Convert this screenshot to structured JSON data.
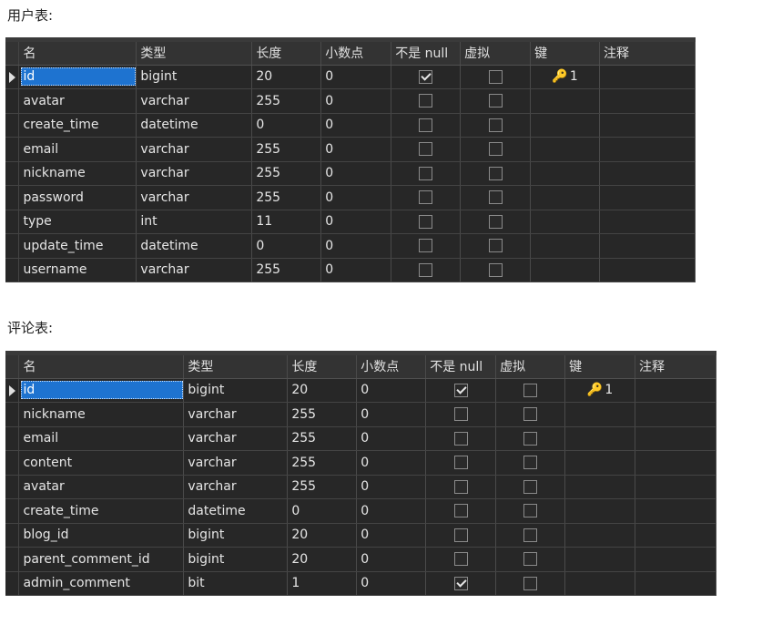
{
  "sections": [
    {
      "caption": "用户表:",
      "headers": [
        "名",
        "类型",
        "长度",
        "小数点",
        "不是 null",
        "虚拟",
        "键",
        "注释"
      ],
      "rows": [
        {
          "name": "id",
          "type": "bigint",
          "length": "20",
          "decimals": "0",
          "not_null": true,
          "virtual": false,
          "key": "1",
          "comment": ""
        },
        {
          "name": "avatar",
          "type": "varchar",
          "length": "255",
          "decimals": "0",
          "not_null": false,
          "virtual": false,
          "key": "",
          "comment": ""
        },
        {
          "name": "create_time",
          "type": "datetime",
          "length": "0",
          "decimals": "0",
          "not_null": false,
          "virtual": false,
          "key": "",
          "comment": ""
        },
        {
          "name": "email",
          "type": "varchar",
          "length": "255",
          "decimals": "0",
          "not_null": false,
          "virtual": false,
          "key": "",
          "comment": ""
        },
        {
          "name": "nickname",
          "type": "varchar",
          "length": "255",
          "decimals": "0",
          "not_null": false,
          "virtual": false,
          "key": "",
          "comment": ""
        },
        {
          "name": "password",
          "type": "varchar",
          "length": "255",
          "decimals": "0",
          "not_null": false,
          "virtual": false,
          "key": "",
          "comment": ""
        },
        {
          "name": "type",
          "type": "int",
          "length": "11",
          "decimals": "0",
          "not_null": false,
          "virtual": false,
          "key": "",
          "comment": ""
        },
        {
          "name": "update_time",
          "type": "datetime",
          "length": "0",
          "decimals": "0",
          "not_null": false,
          "virtual": false,
          "key": "",
          "comment": ""
        },
        {
          "name": "username",
          "type": "varchar",
          "length": "255",
          "decimals": "0",
          "not_null": false,
          "virtual": false,
          "key": "",
          "comment": ""
        }
      ]
    },
    {
      "caption": "评论表:",
      "headers": [
        "名",
        "类型",
        "长度",
        "小数点",
        "不是 null",
        "虚拟",
        "键",
        "注释"
      ],
      "rows": [
        {
          "name": "id",
          "type": "bigint",
          "length": "20",
          "decimals": "0",
          "not_null": true,
          "virtual": false,
          "key": "1",
          "comment": ""
        },
        {
          "name": "nickname",
          "type": "varchar",
          "length": "255",
          "decimals": "0",
          "not_null": false,
          "virtual": false,
          "key": "",
          "comment": ""
        },
        {
          "name": "email",
          "type": "varchar",
          "length": "255",
          "decimals": "0",
          "not_null": false,
          "virtual": false,
          "key": "",
          "comment": ""
        },
        {
          "name": "content",
          "type": "varchar",
          "length": "255",
          "decimals": "0",
          "not_null": false,
          "virtual": false,
          "key": "",
          "comment": ""
        },
        {
          "name": "avatar",
          "type": "varchar",
          "length": "255",
          "decimals": "0",
          "not_null": false,
          "virtual": false,
          "key": "",
          "comment": ""
        },
        {
          "name": "create_time",
          "type": "datetime",
          "length": "0",
          "decimals": "0",
          "not_null": false,
          "virtual": false,
          "key": "",
          "comment": ""
        },
        {
          "name": "blog_id",
          "type": "bigint",
          "length": "20",
          "decimals": "0",
          "not_null": false,
          "virtual": false,
          "key": "",
          "comment": ""
        },
        {
          "name": "parent_comment_id",
          "type": "bigint",
          "length": "20",
          "decimals": "0",
          "not_null": false,
          "virtual": false,
          "key": "",
          "comment": ""
        },
        {
          "name": "admin_comment",
          "type": "bit",
          "length": "1",
          "decimals": "0",
          "not_null": true,
          "virtual": false,
          "key": "",
          "comment": ""
        }
      ]
    }
  ],
  "icons": {
    "key": "key-icon",
    "current_row": "row-pointer-icon",
    "checkbox": "checkbox-icon"
  }
}
